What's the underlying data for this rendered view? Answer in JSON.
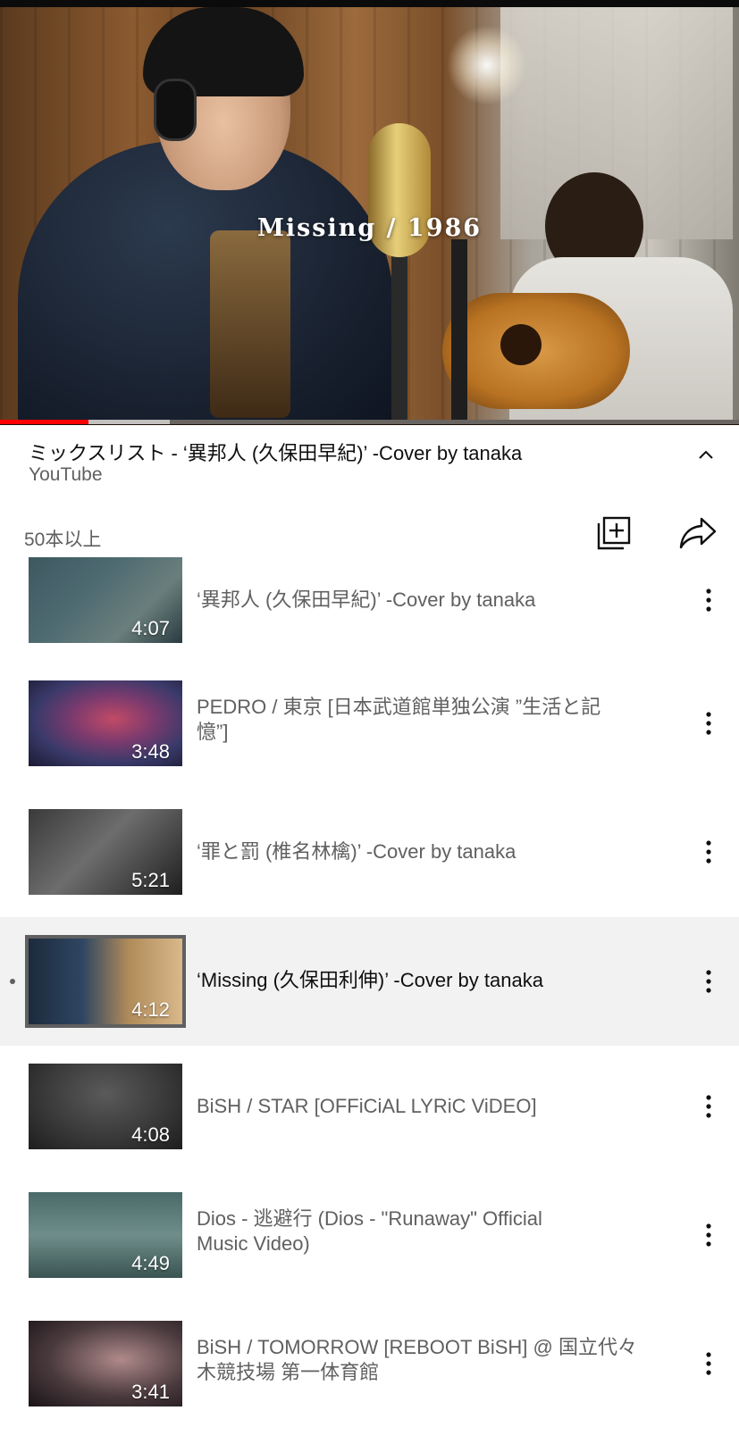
{
  "player": {
    "overlay_title": "Missing / 1986",
    "progress_played": 0.12,
    "progress_buffered": 0.23
  },
  "playlist": {
    "title": "ミックスリスト - ‘異邦人 (久保田早紀)’ -Cover by tanaka",
    "channel": "YouTube",
    "count": "50本以上",
    "save_icon": "add-to-library-icon",
    "share_icon": "share-icon",
    "collapse_icon": "chevron-up-icon"
  },
  "items": [
    {
      "title": "‘異邦人 (久保田早紀)’ -Cover by tanaka",
      "duration": "4:07",
      "active": false
    },
    {
      "title": "PEDRO / 東京 [日本武道館単独公演 ”生活と記憶”]",
      "duration": "3:48",
      "active": false
    },
    {
      "title": "‘罪と罰 (椎名林檎)’ -Cover by tanaka",
      "duration": "5:21",
      "active": false
    },
    {
      "title": "‘Missing (久保田利伸)’ -Cover by tanaka",
      "duration": "4:12",
      "active": true
    },
    {
      "title": "BiSH / STAR [OFFiCiAL LYRiC ViDEO]",
      "duration": "4:08",
      "active": false
    },
    {
      "title": "Dios - 逃避行 (Dios - \"Runaway\" Official Music Video)",
      "duration": "4:49",
      "active": false
    },
    {
      "title": "BiSH / TOMORROW [REBOOT BiSH] @ 国立代々木競技場 第一体育館",
      "duration": "3:41",
      "active": false
    }
  ],
  "colors": {
    "accent": "#ff0000",
    "secondary_text": "#606060",
    "active_row": "#f2f2f2"
  }
}
